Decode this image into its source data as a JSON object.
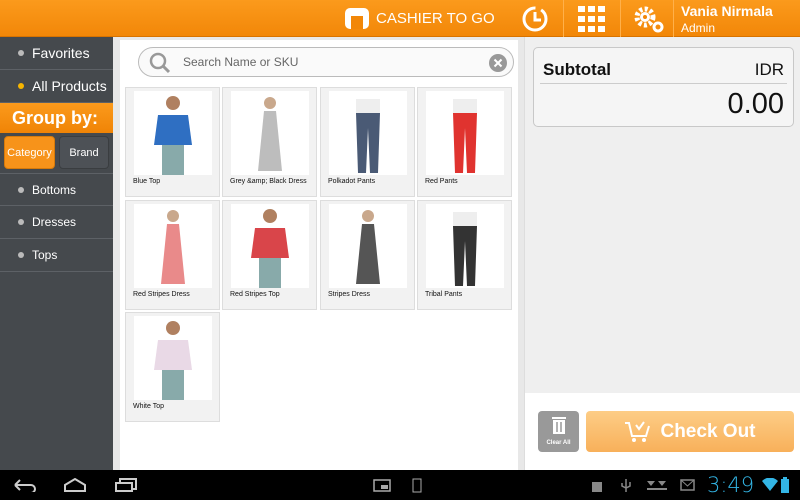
{
  "header": {
    "app_name": "CASHIER TO GO",
    "user_name": "Vania Nirmala",
    "user_role": "Admin",
    "accent": "#f7900f"
  },
  "sidebar": {
    "items": [
      {
        "label": "Favorites"
      },
      {
        "label": "All Products"
      }
    ],
    "group_by_label": "Group by:",
    "group_buttons": [
      {
        "label": "Category",
        "active": true
      },
      {
        "label": "Brand",
        "active": false
      }
    ],
    "categories": [
      {
        "label": "Bottoms"
      },
      {
        "label": "Dresses"
      },
      {
        "label": "Tops"
      }
    ]
  },
  "search": {
    "placeholder": "Search Name or SKU",
    "value": ""
  },
  "products": [
    {
      "name": "Blue Top",
      "color": "#2f6fc2"
    },
    {
      "name": "Grey &amp; Black Dress",
      "color": "#bdbdbd"
    },
    {
      "name": "Polkadot Pants",
      "color": "#4a5a75"
    },
    {
      "name": "Red Pants",
      "color": "#e0332f"
    },
    {
      "name": "Red Stripes Dress",
      "color": "#e98a8a"
    },
    {
      "name": "Red Stripes Top",
      "color": "#d9454a"
    },
    {
      "name": "Stripes Dress",
      "color": "#555555"
    },
    {
      "name": "Tribal Pants",
      "color": "#333333"
    },
    {
      "name": "White Top",
      "color": "#e9d9e6"
    }
  ],
  "cart": {
    "subtotal_label": "Subtotal",
    "currency": "IDR",
    "subtotal": "0.00",
    "clear_all_label": "Clear All",
    "checkout_label": "Check Out"
  },
  "statusbar": {
    "time": "3:49"
  }
}
